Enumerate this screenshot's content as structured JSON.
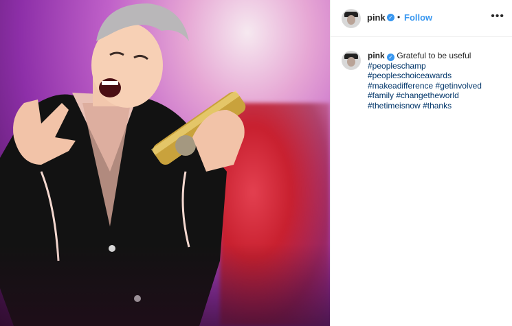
{
  "post": {
    "username": "pink",
    "verified_symbol": "✓",
    "separator": "•",
    "follow_label": "Follow",
    "more_label": "•••",
    "caption_text": "Grateful to be useful",
    "hashtags": {
      "line1": "#peopleschamp",
      "line2": "#peopleschoiceawards",
      "line3a": "#makeadifference",
      "line3b": "#getinvolved",
      "line4a": "#family",
      "line4b": "#changetheworld",
      "line5a": "#thetimeisnow",
      "line5b": "#thanks"
    }
  },
  "colors": {
    "link": "#3897f0",
    "hashtag": "#003569",
    "text": "#262626",
    "border": "#efefef"
  },
  "icons": {
    "verified": "verified-badge-icon",
    "more": "more-options-icon"
  }
}
